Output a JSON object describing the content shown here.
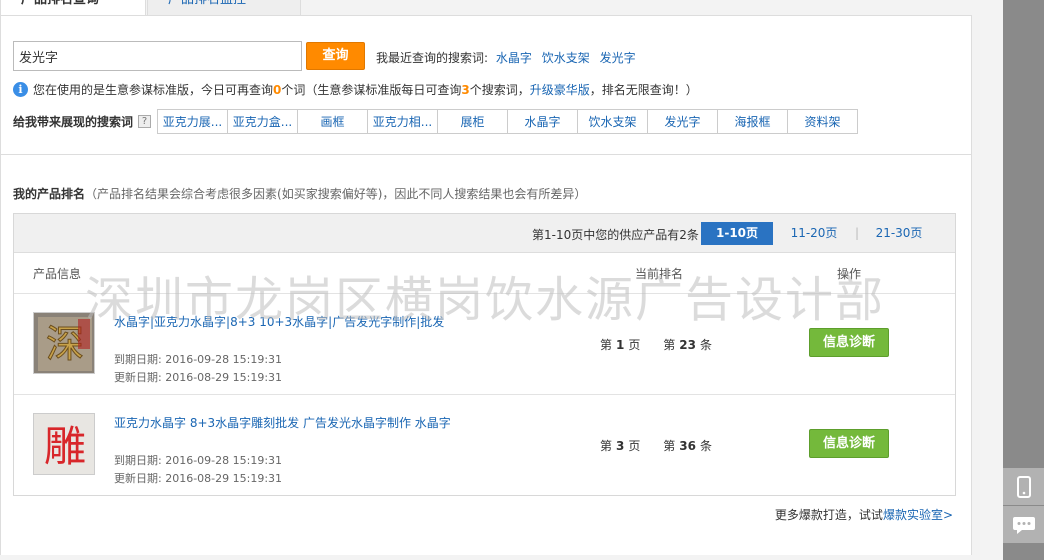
{
  "tabs": [
    {
      "label": "产品排名查询",
      "active": true
    },
    {
      "label": "产品排名监控",
      "active": false
    }
  ],
  "search": {
    "value": "发光字",
    "button_label": "查询",
    "recent_label": "我最近查询的搜索词:",
    "recent": [
      "水晶字",
      "饮水支架",
      "发光字"
    ]
  },
  "info": {
    "text1": "您在使用的是生意参谋标准版，今日可再查询",
    "remaining": "0",
    "text2": "个词（生意参谋标准版每日可查询",
    "daily": "3",
    "text3": "个搜索词，",
    "upgrade": "升级豪华版",
    "text4": "，排名无限查询！）"
  },
  "keywords": {
    "label": "给我带来展现的搜索词",
    "help": "?",
    "items": [
      "亚克力展...",
      "亚克力盒...",
      "画框",
      "亚克力相...",
      "展柜",
      "水晶字",
      "饮水支架",
      "发光字",
      "海报框",
      "资料架"
    ]
  },
  "ranking": {
    "title": "我的产品排名",
    "subtitle": "（产品排名结果会综合考虑很多因素(如买家搜索偏好等)，因此不同人搜索结果也会有所差异）",
    "pager_info": "第1-10页中您的供应产品有2条",
    "pages": [
      "1-10页",
      "11-20页",
      "21-30页"
    ],
    "pager_sep": "|",
    "columns": [
      "产品信息",
      "当前排名",
      "操作"
    ],
    "rows": [
      {
        "title": "水晶字|亚克力水晶字|8+3  10+3水晶字|广告发光字制作|批发",
        "expire": "到期日期: 2016-09-28 15:19:31",
        "updated": "更新日期: 2016-08-29 15:19:31",
        "page_prefix": "第",
        "page": "1",
        "page_suffix": "页",
        "item_prefix": "第",
        "item": "23",
        "item_suffix": "条",
        "button": "信息诊断"
      },
      {
        "title": "亚克力水晶字 8+3水晶字雕刻批发 广告发光水晶字制作 水晶字",
        "expire": "到期日期: 2016-09-28 15:19:31",
        "updated": "更新日期: 2016-08-29 15:19:31",
        "page_prefix": "第",
        "page": "3",
        "page_suffix": "页",
        "item_prefix": "第",
        "item": "36",
        "item_suffix": "条",
        "button": "信息诊断"
      }
    ],
    "more_text": "更多爆款打造，试试",
    "more_link": "爆款实验室>"
  },
  "watermark": "深圳市龙岗区横岗饮水源广告设计部",
  "colors": {
    "accent": "#ff8a00",
    "link": "#1a66b3",
    "primary": "#2a73c2",
    "green": "#74b93b"
  }
}
